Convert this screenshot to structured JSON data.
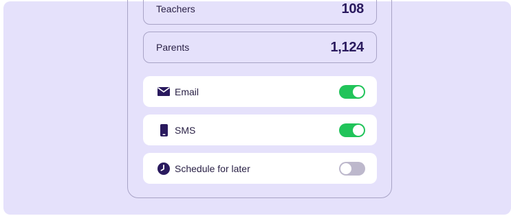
{
  "stats": [
    {
      "label": "Teachers",
      "value": "108"
    },
    {
      "label": "Parents",
      "value": "1,124"
    }
  ],
  "channels": [
    {
      "label": "Email",
      "icon": "envelope-icon",
      "enabled": true
    },
    {
      "label": "SMS",
      "icon": "phone-icon",
      "enabled": true
    },
    {
      "label": "Schedule for later",
      "icon": "clock-icon",
      "enabled": false
    }
  ],
  "colors": {
    "background": "#e5e1fb",
    "accent_dark": "#2a1a5e",
    "toggle_on": "#21c45a",
    "toggle_off": "#bdb8cc"
  }
}
